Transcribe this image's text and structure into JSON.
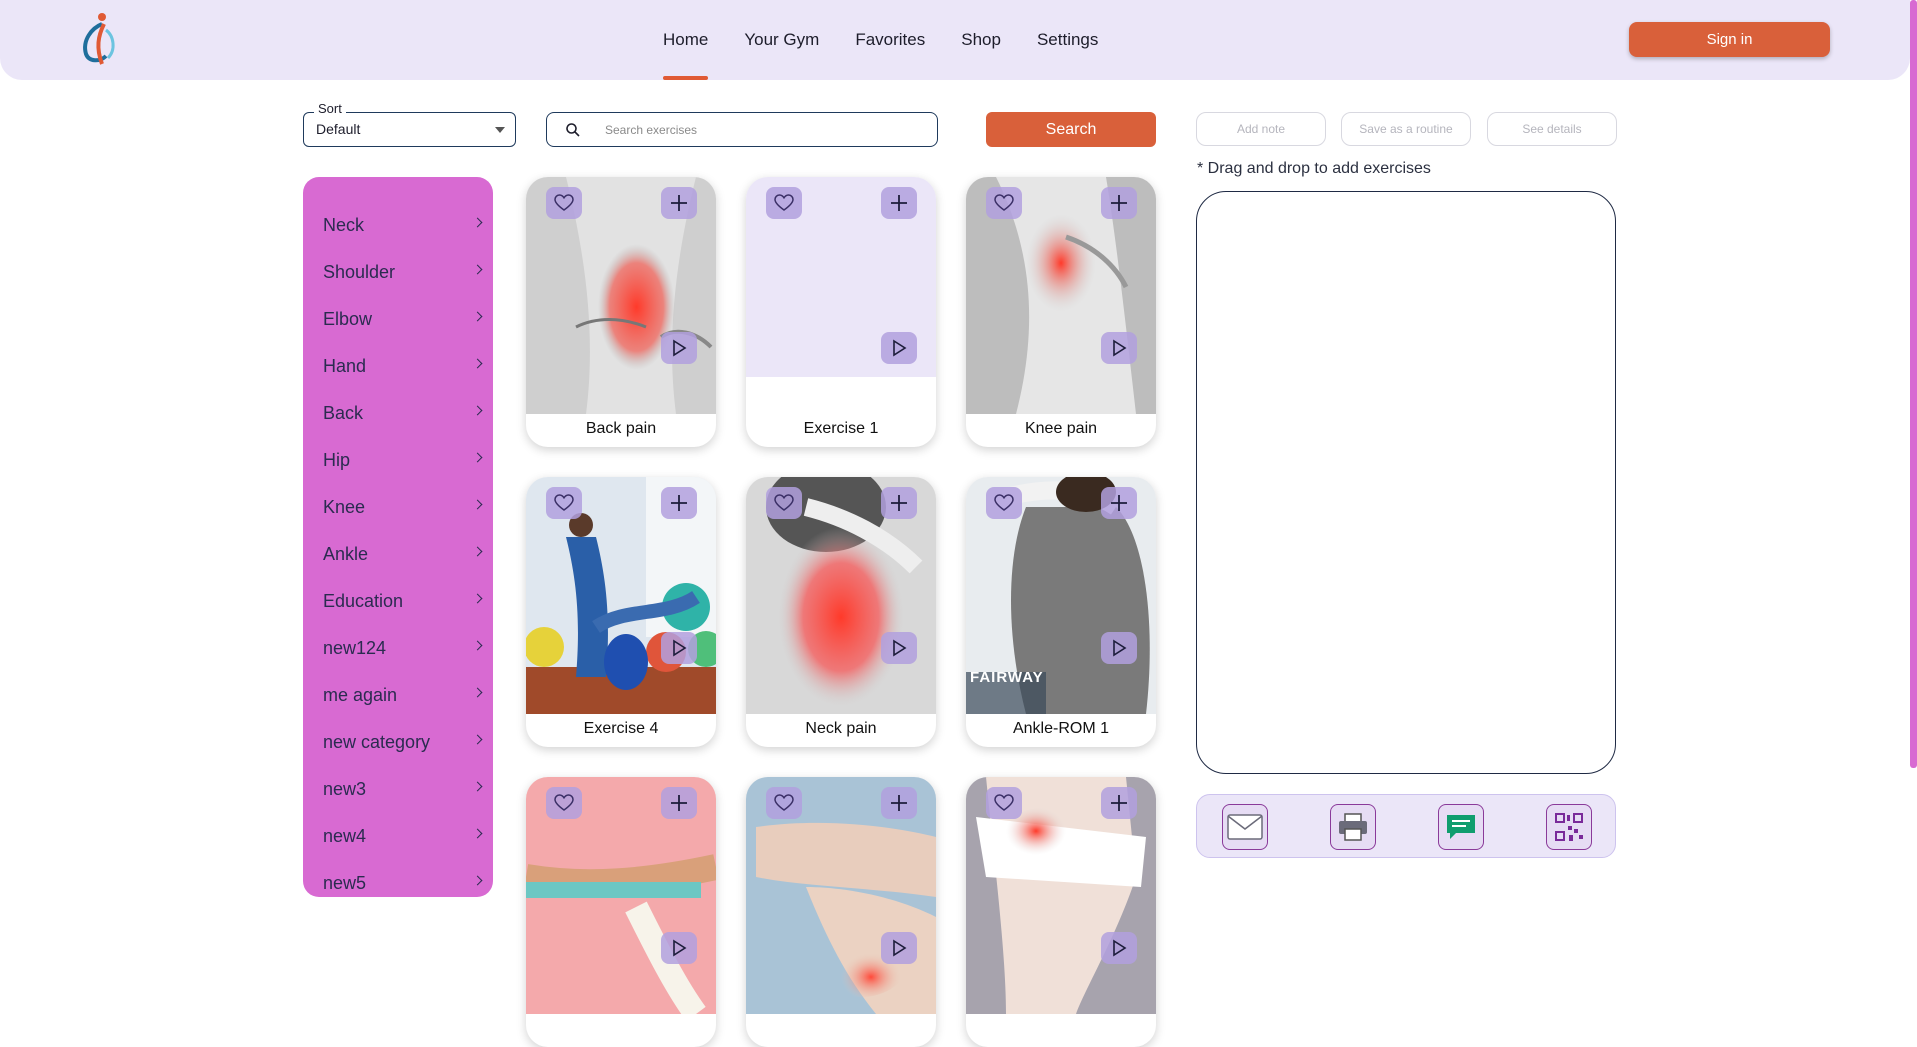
{
  "header": {
    "logo_icon": "person-logo-icon",
    "nav": [
      {
        "label": "Home",
        "active": true
      },
      {
        "label": "Your Gym",
        "active": false
      },
      {
        "label": "Favorites",
        "active": false
      },
      {
        "label": "Shop",
        "active": false
      },
      {
        "label": "Settings",
        "active": false
      }
    ],
    "signin_label": "Sign in"
  },
  "colors": {
    "accent": "#d9603a",
    "sidebar": "#d86ad2",
    "header_bg": "#ebe6f8",
    "button_overlay": "#b2a0de"
  },
  "toolbar": {
    "sort_label": "Sort",
    "sort_value": "Default",
    "search_placeholder": "Search exercises",
    "search_button": "Search"
  },
  "sidebar": {
    "items": [
      {
        "label": "Neck"
      },
      {
        "label": "Shoulder"
      },
      {
        "label": "Elbow"
      },
      {
        "label": "Hand"
      },
      {
        "label": "Back"
      },
      {
        "label": "Hip"
      },
      {
        "label": "Knee"
      },
      {
        "label": "Ankle"
      },
      {
        "label": "Education"
      },
      {
        "label": "new124"
      },
      {
        "label": "me again"
      },
      {
        "label": "new category"
      },
      {
        "label": "new3"
      },
      {
        "label": "new4"
      },
      {
        "label": "new5"
      }
    ]
  },
  "exercises": [
    {
      "title": "Back pain",
      "image": "back-pain-photo"
    },
    {
      "title": "Exercise 1",
      "image": "blank"
    },
    {
      "title": "Knee pain",
      "image": "knee-pain-photo"
    },
    {
      "title": "Exercise 4",
      "image": "physio-session-photo"
    },
    {
      "title": "Neck pain",
      "image": "neck-pain-photo"
    },
    {
      "title": "Ankle-ROM 1",
      "image": "chiropractic-photo",
      "watermark": "FAIRWAY"
    },
    {
      "title": "",
      "image": "resistance-band-photo"
    },
    {
      "title": "",
      "image": "hand-stretch-photo"
    },
    {
      "title": "",
      "image": "hip-pain-photo"
    }
  ],
  "routine": {
    "add_note": "Add note",
    "save_routine": "Save as a routine",
    "see_details": "See details",
    "hint": "* Drag and drop to add exercises",
    "share_icons": [
      "mail-icon",
      "printer-icon",
      "message-icon",
      "qr-code-icon"
    ]
  }
}
